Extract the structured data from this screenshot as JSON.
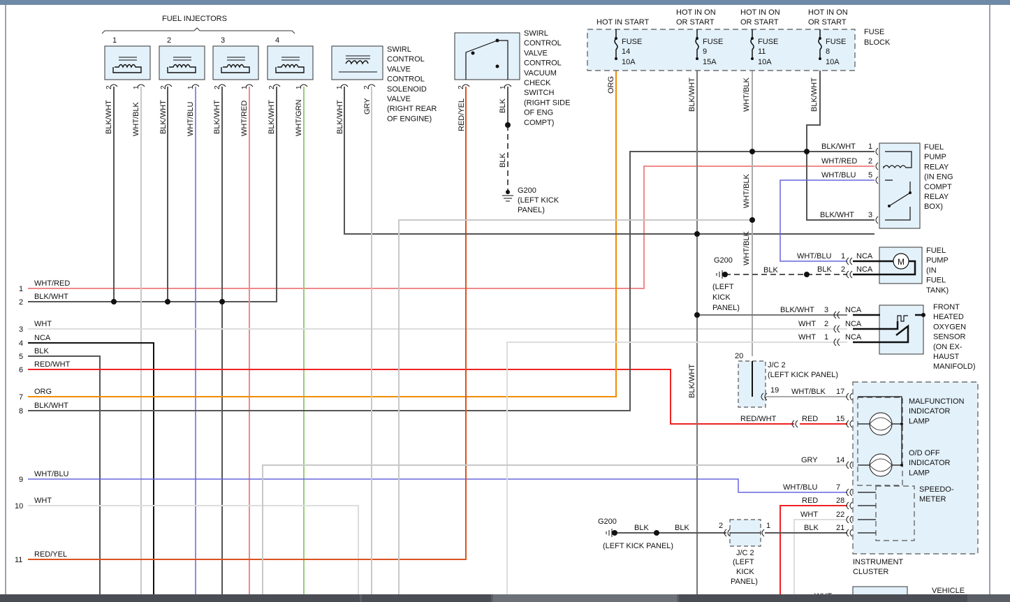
{
  "diagram": {
    "fuel_injectors_title": "FUEL INJECTORS",
    "injector_numbers": [
      "1",
      "2",
      "3",
      "4"
    ],
    "injector_pins": [
      "2",
      "1",
      "2",
      "1",
      "2",
      "1",
      "2",
      "1"
    ],
    "injector_wires": [
      "BLK/WHT",
      "WHT/BLK",
      "BLK/WHT",
      "WHT/BLU",
      "BLK/WHT",
      "WHT/RED",
      "BLK/WHT",
      "WHT/GRN"
    ],
    "swirl_solenoid_label": [
      "SWIRL",
      "CONTROL",
      "VALVE",
      "CONTROL",
      "SOLENOID",
      "VALVE",
      "(RIGHT REAR",
      "OF ENGINE)"
    ],
    "swirl_solenoid_pins": [
      "1",
      "2"
    ],
    "swirl_solenoid_wires": [
      "BLK/WHT",
      "GRY"
    ],
    "swirl_switch_label": [
      "SWIRL",
      "CONTROL",
      "VALVE",
      "CONTROL",
      "VACUUM",
      "CHECK",
      "SWITCH",
      "(RIGHT SIDE",
      "OF ENG",
      "COMPT)"
    ],
    "swirl_switch_pins": [
      "2",
      "1"
    ],
    "swirl_switch_wires": [
      "RED/YEL",
      "BLK"
    ],
    "g200_switch": [
      "G200",
      "(LEFT KICK",
      "PANEL)"
    ],
    "blk_label": "BLK",
    "fuse_block": {
      "label": [
        "FUSE",
        "BLOCK"
      ],
      "hot_labels": [
        [
          "HOT IN START"
        ],
        [
          "HOT IN ON",
          "OR START"
        ],
        [
          "HOT IN ON",
          "OR START"
        ],
        [
          "HOT IN ON",
          "OR START"
        ]
      ],
      "fuses": [
        {
          "name": "FUSE",
          "num": "14",
          "amp": "10A",
          "wire": "ORG"
        },
        {
          "name": "FUSE",
          "num": "9",
          "amp": "15A",
          "wire": "BLK/WHT"
        },
        {
          "name": "FUSE",
          "num": "11",
          "amp": "10A",
          "wire": "WHT/BLK"
        },
        {
          "name": "FUSE",
          "num": "8",
          "amp": "10A",
          "wire": "BLK/WHT"
        }
      ]
    },
    "fuel_pump_relay": {
      "label": [
        "FUEL",
        "PUMP",
        "RELAY",
        "(IN ENG",
        "COMPT",
        "RELAY",
        "BOX)"
      ],
      "pins": [
        {
          "wire": "BLK/WHT",
          "pin": "1"
        },
        {
          "wire": "WHT/RED",
          "pin": "2"
        },
        {
          "wire": "WHT/BLU",
          "pin": "5"
        },
        {
          "wire": "BLK/WHT",
          "pin": "3"
        }
      ]
    },
    "fuel_pump": {
      "label": [
        "FUEL",
        "PUMP",
        "(IN",
        "FUEL",
        "TANK)"
      ],
      "motor": "M",
      "pins": [
        {
          "wire": "WHT/BLU",
          "pin": "1",
          "nca": "NCA"
        },
        {
          "wire": "BLK",
          "pin": "2",
          "nca": "NCA"
        }
      ],
      "g200": [
        "G200",
        "(LEFT",
        "KICK",
        "PANEL)"
      ],
      "blk": "BLK"
    },
    "o2_sensor": {
      "label": [
        "FRONT",
        "HEATED",
        "OXYGEN",
        "SENSOR",
        "(ON EX-",
        "HAUST",
        "MANIFOLD)"
      ],
      "pins": [
        {
          "wire": "BLK/WHT",
          "pin": "3",
          "nca": "NCA"
        },
        {
          "wire": "WHT",
          "pin": "2",
          "nca": "NCA"
        },
        {
          "wire": "WHT",
          "pin": "1",
          "nca": "NCA"
        }
      ]
    },
    "vertical_labels": {
      "wht_blk_1": "WHT/BLK",
      "wht_blk_2": "WHT/BLK",
      "blk_wht": "BLK/WHT"
    },
    "jc2_top": {
      "pin20": "20",
      "pin19": "19",
      "label": [
        "J/C 2",
        "(LEFT KICK PANEL)"
      ],
      "wire": "WHT/BLK",
      "pin17": "17"
    },
    "instrument_cluster": {
      "label": [
        "INSTRUMENT",
        "CLUSTER"
      ],
      "mil_label": [
        "MALFUNCTION",
        "INDICATOR",
        "LAMP"
      ],
      "od_label": [
        "O/D OFF",
        "INDICATOR",
        "LAMP"
      ],
      "speedo_label": [
        "SPEEDO-",
        "METER"
      ],
      "rows": [
        {
          "wire": "RED/WHT",
          "wire2": "RED",
          "pin": "15"
        },
        {
          "wire": "GRY",
          "pin": "14"
        },
        {
          "wire": "WHT/BLU",
          "pin": "7"
        },
        {
          "wire": "RED",
          "pin": "28"
        },
        {
          "wire": "WHT",
          "pin": "22"
        },
        {
          "wire": "BLK",
          "pin": "21"
        }
      ]
    },
    "jc2_bottom": {
      "label": [
        "J/C 2",
        "(LEFT",
        "KICK",
        "PANEL)"
      ],
      "pin2": "2",
      "pin1": "1",
      "g200": "G200",
      "g200_sub": "(LEFT KICK PANEL)",
      "blk1": "BLK",
      "blk2": "BLK"
    },
    "vertical_blk_wht_2": "BLK/WHT",
    "vehicle_label": "VEHICLE",
    "bottom_partial": "WHT",
    "ecm_pins": [
      {
        "num": "1",
        "wire": "WHT/RED"
      },
      {
        "num": "2",
        "wire": "BLK/WHT"
      },
      {
        "num": "3",
        "wire": "WHT"
      },
      {
        "num": "4",
        "wire": "NCA"
      },
      {
        "num": "5",
        "wire": "BLK"
      },
      {
        "num": "6",
        "wire": "RED/WHT"
      },
      {
        "num": "7",
        "wire": "ORG"
      },
      {
        "num": "8",
        "wire": "BLK/WHT"
      },
      {
        "num": "9",
        "wire": "WHT/BLU"
      },
      {
        "num": "10",
        "wire": "WHT"
      },
      {
        "num": "11",
        "wire": "RED/YEL"
      }
    ]
  },
  "colors": {
    "wire_dark": "#555555",
    "wire_light": "#c8c8c8",
    "wire_pink": "#ef8a8a",
    "wire_blue": "#6666dd",
    "wire_green": "#99cc77",
    "wire_red": "#ee2222",
    "wire_orange": "#f28c00",
    "wire_redyel": "#d9531e",
    "wire_black": "#111111",
    "component_fill": "#e3f1fa"
  }
}
